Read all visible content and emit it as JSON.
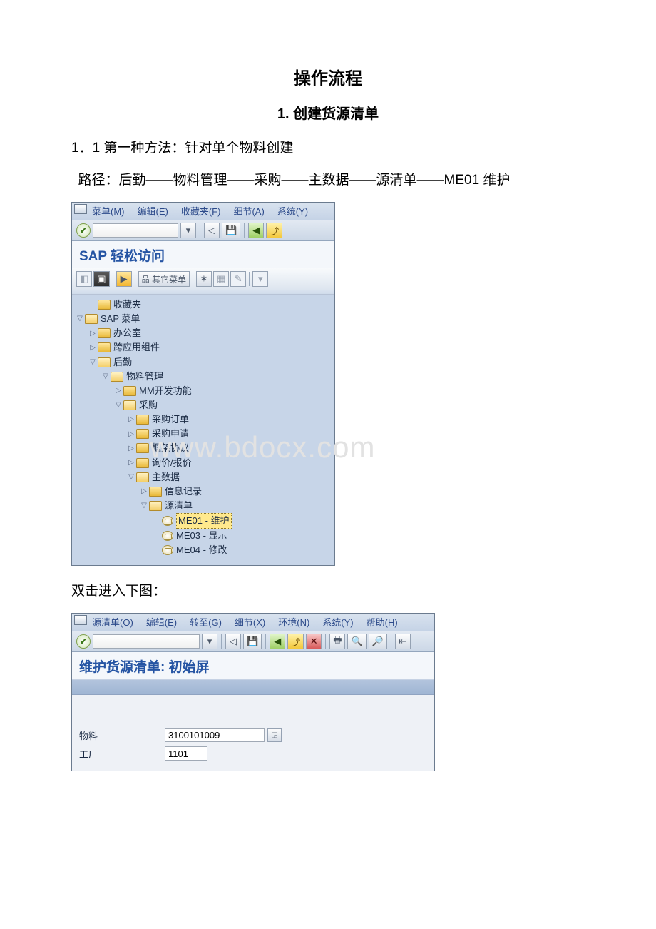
{
  "doc": {
    "title": "操作流程",
    "heading": "1. 创建货源清单",
    "section": "1．1 第一种方法：针对单个物料创建",
    "path": " 路径：后勤——物料管理——采购——主数据——源清单——ME01 维护",
    "after_tree": "双击进入下图：",
    "watermark": "www.bdocx.com"
  },
  "sap1": {
    "menu": [
      "菜单(M)",
      "编辑(E)",
      "收藏夹(F)",
      "细节(A)",
      "系统(Y)"
    ],
    "title": "SAP 轻松访问",
    "appbar_other": "其它菜单",
    "tree": {
      "favorites": "收藏夹",
      "sap_menu": "SAP 菜单",
      "office": "办公室",
      "cross": "跨应用组件",
      "logistics": "后勤",
      "mm": "物料管理",
      "mmdev": "MM开发功能",
      "purchasing": "采购",
      "po": "采购订单",
      "pr": "采购申请",
      "outline": "框架协议",
      "rfq": "询价/报价",
      "master": "主数据",
      "info": "信息记录",
      "source": "源清单",
      "me01": "ME01 - 维护",
      "me03": "ME03 - 显示",
      "me04": "ME04 - 修改"
    }
  },
  "sap2": {
    "menu": [
      "源清单(O)",
      "编辑(E)",
      "转至(G)",
      "细节(X)",
      "环境(N)",
      "系统(Y)",
      "帮助(H)"
    ],
    "title": "维护货源清单: 初始屏",
    "labels": {
      "material": "物料",
      "plant": "工厂"
    },
    "values": {
      "material": "3100101009",
      "plant": "1101"
    }
  }
}
